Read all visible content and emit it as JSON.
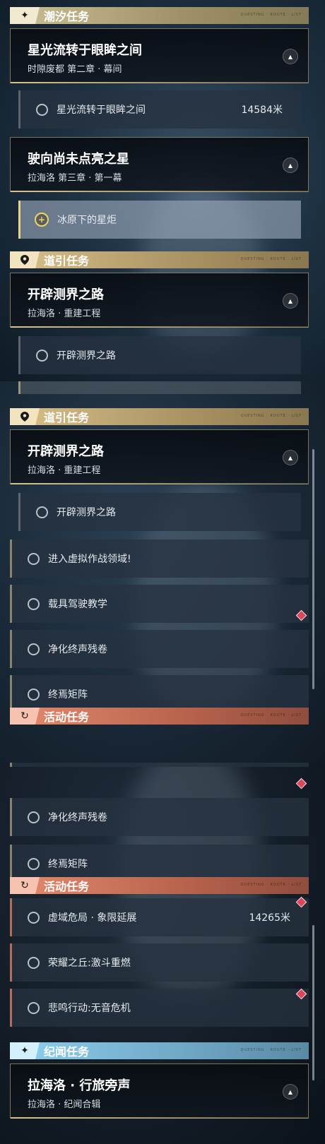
{
  "sections": {
    "tide": {
      "label": "潮汐任务",
      "icon": "sparkle-icon",
      "glyph": "✦",
      "color": "#cbbf95"
    },
    "guide": {
      "label": "道引任务",
      "icon": "location-pin-icon",
      "glyph": "📍",
      "color": "#d9c08b"
    },
    "event": {
      "label": "活动任务",
      "icon": "activity-icon",
      "glyph": "↻",
      "color": "#e58a6e"
    },
    "legend": {
      "label": "纪闻任务",
      "icon": "sparkle-icon",
      "glyph": "✦",
      "color": "#8fd0ef"
    }
  },
  "chapters": {
    "starlight": {
      "title": "星光流转于眼眸之间",
      "subtitle": "时隙废都 第二章 · 幕间"
    },
    "unlit": {
      "title": "驶向尚未点亮之星",
      "subtitle": "拉海洛 第三章 · 第一幕"
    },
    "pathfinder": {
      "title": "开辟测界之路",
      "subtitle": "拉海洛 · 重建工程"
    },
    "travel": {
      "title": "拉海洛 · 行旅旁声",
      "subtitle": "拉海洛 · 纪闻合辑"
    }
  },
  "tasks": {
    "starlight": {
      "name": "星光流转于眼眸之间",
      "distance": "14584米"
    },
    "torch": {
      "name": "冰原下的星炬"
    },
    "pathfinder": {
      "name": "开辟测界之路"
    },
    "virtual": {
      "name": "进入虚拟作战领域!"
    },
    "vehicle": {
      "name": "载具驾驶教学"
    },
    "purify": {
      "name": "净化终声残卷"
    },
    "matrix": {
      "name": "终焉矩阵"
    },
    "domain": {
      "name": "虚域危局 · 象限延展",
      "distance": "14265米"
    },
    "glory": {
      "name": "荣耀之丘:激斗重燃"
    },
    "lament": {
      "name": "悲鸣行动:无音危机"
    }
  },
  "ui": {
    "collapse_glyph": "▲",
    "header_tag": "QUESTING · ROUTE · LIST"
  }
}
